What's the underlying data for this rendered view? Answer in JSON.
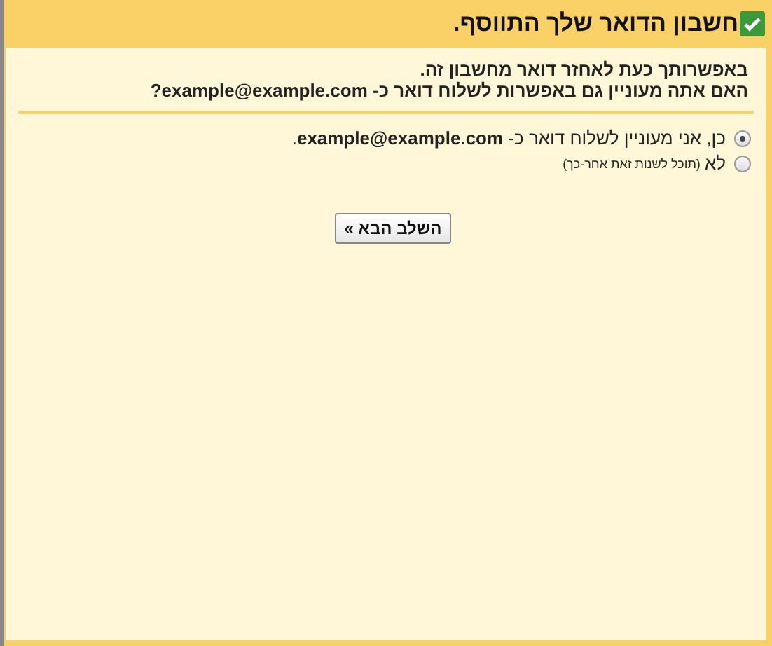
{
  "header": {
    "title": "חשבון הדואר שלך התווסף.",
    "checked": true
  },
  "intro": [
    "באפשרותך כעת לאחזר דואר מחשבון זה.",
    "האם אתה מעוניין גם באפשרות לשלוח דואר כ- example@example.com?"
  ],
  "options": [
    {
      "label": "כן, אני מעוניין לשלוח דואר כ- **example@example.com**.",
      "selected": true
    },
    {
      "label": "לא",
      "note": "(תוכל לשנות זאת אחר-כך)",
      "selected": false
    }
  ],
  "button": "השלב הבא »"
}
